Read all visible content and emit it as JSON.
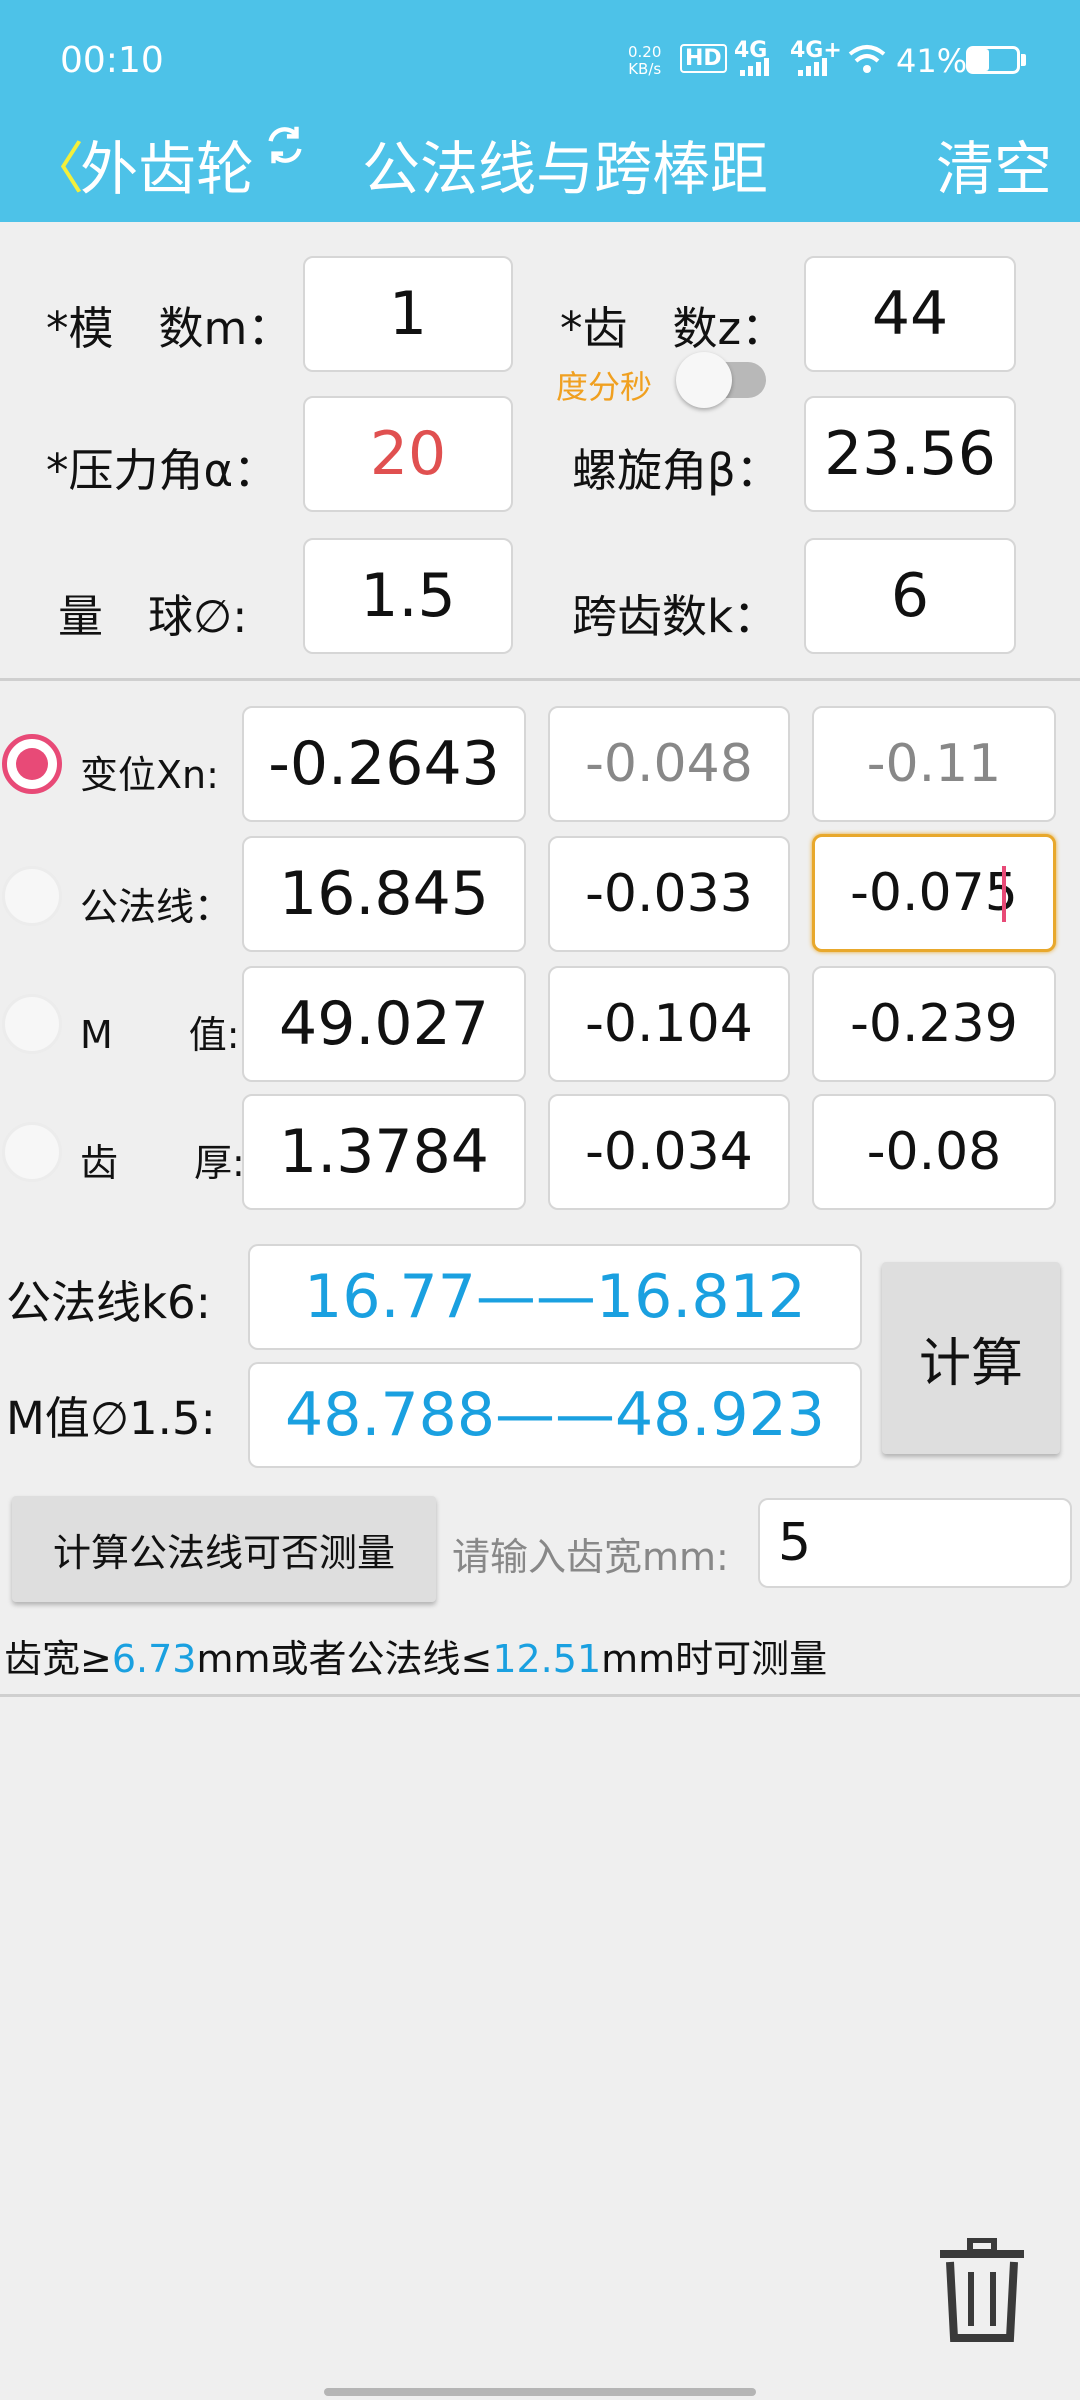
{
  "status": {
    "time": "00:10",
    "net_speed_top": "0.20",
    "net_speed_bottom": "KB/s",
    "hd": "HD",
    "sig1": "4G",
    "sig2": "4G+",
    "battery": "41%"
  },
  "header": {
    "back_glyph": "〈",
    "mode": "外齿轮",
    "title": "公法线与跨棒距",
    "clear": "清空"
  },
  "inputs": {
    "module_label": "*模　数m：",
    "module_value": "1",
    "teeth_label": "*齿　数z：",
    "teeth_value": "44",
    "dms_label": "度分秒",
    "pressure_label": "*压力角α：",
    "pressure_value": "20",
    "helix_label": "螺旋角β：",
    "helix_value": "23.56",
    "ball_label": "量　球∅:",
    "ball_value": "1.5",
    "span_label": "跨齿数k：",
    "span_value": "6"
  },
  "rows": [
    {
      "label": "变位Xn:",
      "v1": "-0.2643",
      "v2": "-0.048",
      "v3": "-0.11"
    },
    {
      "label": "公法线：",
      "v1": "16.845",
      "v2": "-0.033",
      "v3": "-0.075"
    },
    {
      "label": "M　　值:",
      "v1": "49.027",
      "v2": "-0.104",
      "v3": "-0.239"
    },
    {
      "label": "齿　　厚:",
      "v1": "1.3784",
      "v2": "-0.034",
      "v3": "-0.08"
    }
  ],
  "results": {
    "wk_label": "公法线k6:",
    "wk_value": "16.77——16.812",
    "m_label": "M值∅1.5:",
    "m_value": "48.788——48.923",
    "calc": "计算"
  },
  "measure": {
    "button": "计算公法线可否测量",
    "width_label": "请输入齿宽mm:",
    "width_value": "5"
  },
  "result_line": {
    "p1": "齿宽≥",
    "v1": "6.73",
    "p2": "mm或者公法线≤",
    "v2": "12.51",
    "p3": "mm时可测量"
  },
  "colors": {
    "header": "#4dc2e8",
    "accent_blue": "#1aa0e0",
    "radio_pink": "#e84a77",
    "pressure_red": "#e05050",
    "label_orange": "#f0a020",
    "focus_border": "#e8a82c"
  },
  "icons": {
    "refresh": "refresh-icon",
    "trash": "trash-icon",
    "wifi": "wifi-icon",
    "battery": "battery-icon"
  }
}
